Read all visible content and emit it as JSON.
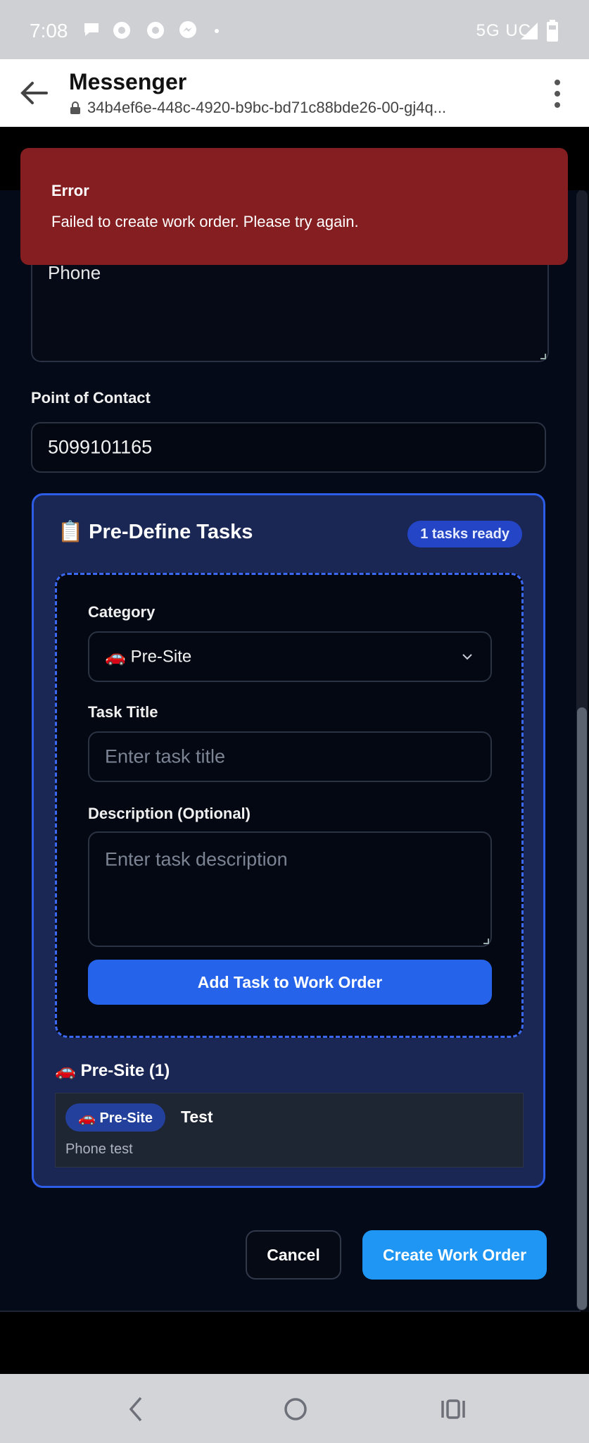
{
  "status_bar": {
    "time": "7:08",
    "network": "5G UC",
    "icons": [
      "chat-bubble-icon",
      "settings-icon",
      "settings-icon",
      "messenger-icon",
      "dot-icon"
    ]
  },
  "app_bar": {
    "title": "Messenger",
    "url": "34b4ef6e-448c-4920-b9bc-bd71c88bde26-00-gj4q..."
  },
  "toast": {
    "title": "Error",
    "message": "Failed to create work order. Please try again.",
    "color": "#841e20"
  },
  "form": {
    "phone_field_value": "Phone",
    "point_of_contact_label": "Point of Contact",
    "point_of_contact_value": "5099101165"
  },
  "tasks": {
    "icon": "📋",
    "title": "Pre-Define Tasks",
    "ready_badge": "1 tasks ready",
    "category_label": "Category",
    "category_icon": "🚗",
    "category_value": "Pre-Site",
    "task_title_label": "Task Title",
    "task_title_placeholder": "Enter task title",
    "description_label": "Description (Optional)",
    "description_placeholder": "Enter task description",
    "add_button": "Add Task to Work Order",
    "group_icon": "🚗",
    "group_label": "Pre-Site (1)",
    "items": [
      {
        "chip_icon": "🚗",
        "chip": "Pre-Site",
        "title": "Test",
        "description": "Phone test"
      }
    ]
  },
  "actions": {
    "cancel": "Cancel",
    "create": "Create Work Order",
    "accent": "#1f96f3"
  }
}
